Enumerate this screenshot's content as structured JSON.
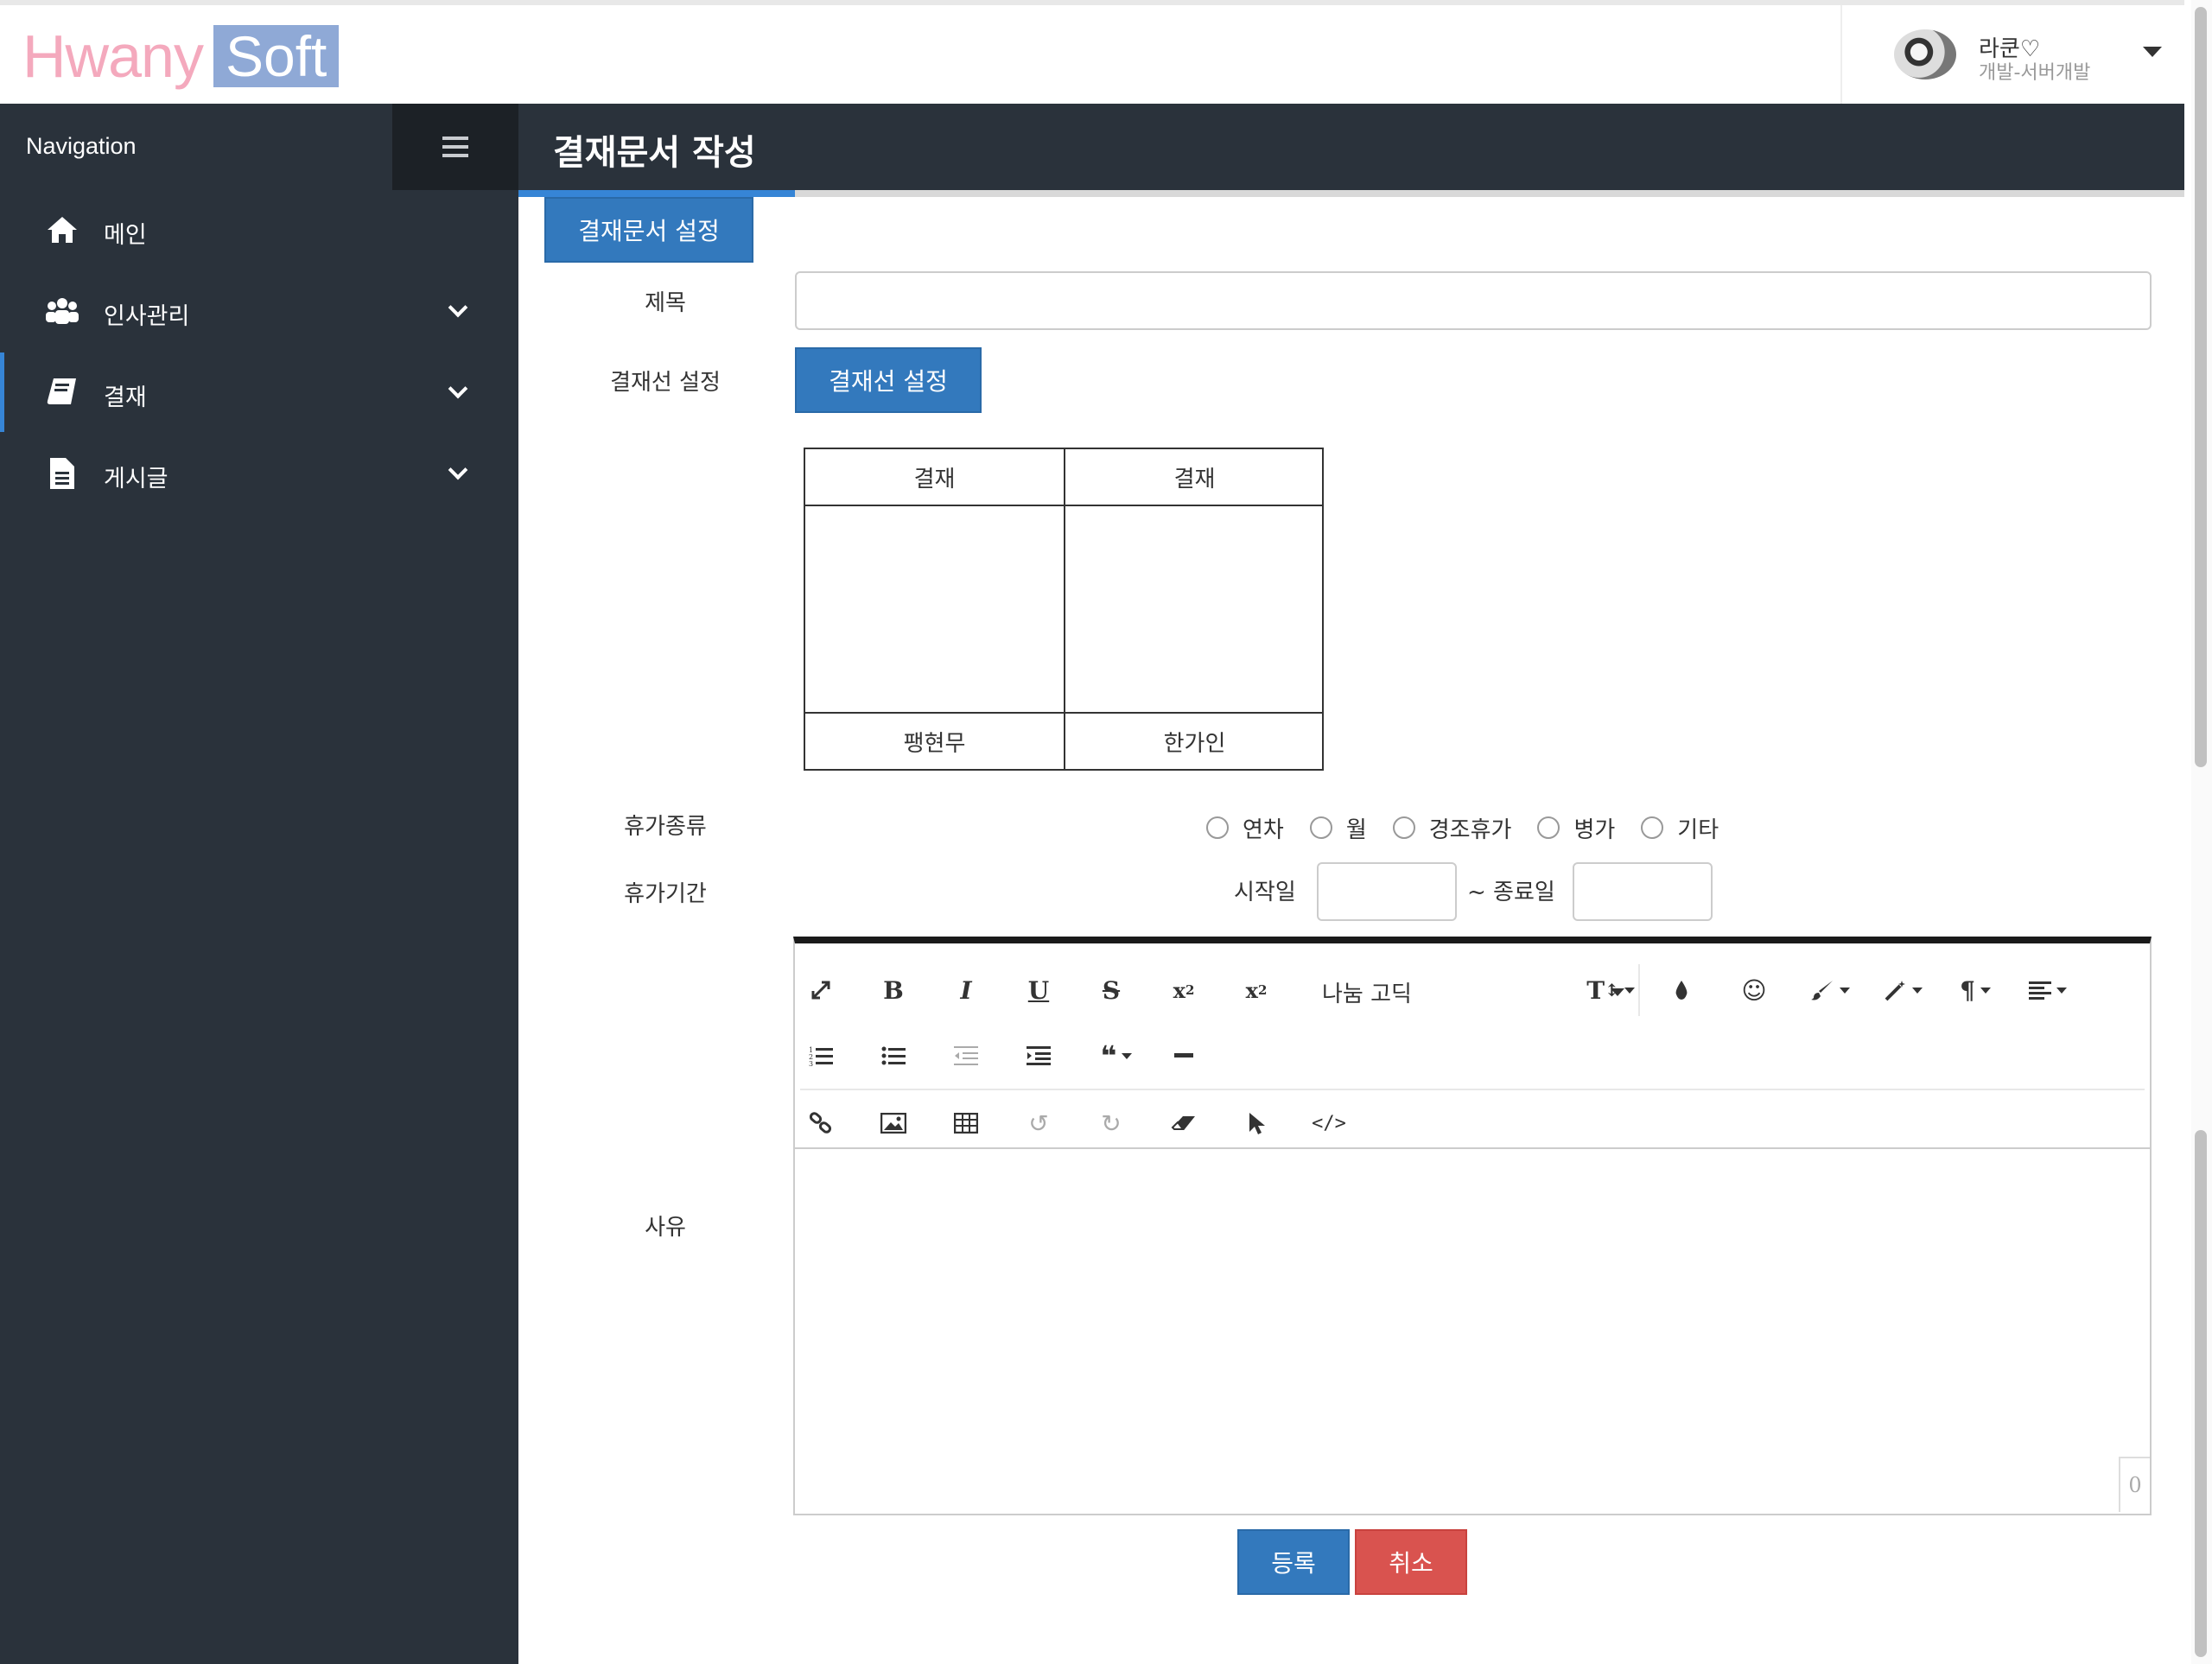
{
  "logo": {
    "part1": "Hwany",
    "part2": "Soft"
  },
  "user": {
    "name": "라쿤♡",
    "position": "개발-서버개발"
  },
  "sidebar": {
    "title": "Navigation",
    "items": [
      {
        "label": "메인",
        "icon": "home-icon"
      },
      {
        "label": "인사관리",
        "icon": "users-icon"
      },
      {
        "label": "결재",
        "icon": "book-icon"
      },
      {
        "label": "게시글",
        "icon": "document-icon"
      }
    ]
  },
  "page": {
    "title": "결재문서 작성",
    "tab_label": "결재문서 설정"
  },
  "form": {
    "subject_label": "제목",
    "subject_value": "",
    "approval_line_label": "결재선 설정",
    "approval_line_button": "결재선 설정",
    "approval_table": {
      "headers": [
        "결재",
        "결재"
      ],
      "names": [
        "팽현무",
        "한가인"
      ]
    },
    "leave_type_label": "휴가종류",
    "leave_types": [
      "연차",
      "월",
      "경조휴가",
      "병가",
      "기타"
    ],
    "leave_period_label": "휴가기간",
    "start_label": "시작일",
    "end_label": "~ 종료일",
    "reason_label": "사유",
    "reason_value": "",
    "char_count": "0"
  },
  "editor": {
    "font_name": "나눔 고딕",
    "tools_row1": [
      "expand-icon",
      "bold-icon",
      "italic-icon",
      "underline-icon",
      "strikethrough-icon",
      "subscript-icon",
      "superscript-icon",
      "font-size-icon",
      "color-drop-icon",
      "emoji-icon",
      "brush-icon",
      "magic-icon",
      "paragraph-icon",
      "align-icon"
    ],
    "tools_row2": [
      "ordered-list-icon",
      "unordered-list-icon",
      "outdent-icon",
      "indent-icon",
      "blockquote-icon",
      "horizontal-rule-icon"
    ],
    "tools_row3": [
      "link-icon",
      "image-icon",
      "table-icon",
      "undo-icon",
      "redo-icon",
      "eraser-icon",
      "pointer-icon",
      "code-view-icon"
    ]
  },
  "buttons": {
    "submit": "등록",
    "cancel": "취소"
  },
  "colors": {
    "primary": "#3379bd",
    "danger": "#d9534f",
    "sidebar": "#2a323b",
    "accent": "#3685d6"
  }
}
